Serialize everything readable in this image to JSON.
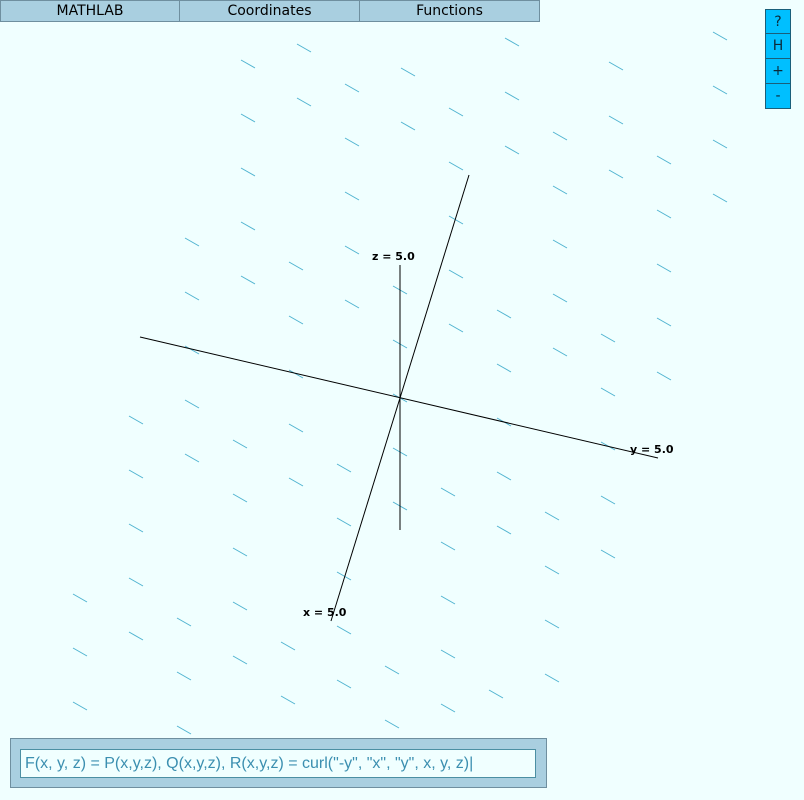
{
  "menu": {
    "tabs": [
      {
        "label": "MATHLAB"
      },
      {
        "label": "Coordinates"
      },
      {
        "label": "Functions"
      }
    ]
  },
  "side_buttons": [
    {
      "label": "?"
    },
    {
      "label": "H"
    },
    {
      "label": "+"
    },
    {
      "label": "-"
    }
  ],
  "axes": {
    "x_label": "x = 5.0",
    "y_label": "y = 5.0",
    "z_label": "z = 5.0"
  },
  "command": {
    "value": "F(x, y, z) = P(x,y,z), Q(x,y,z), R(x,y,z) = curl(\"-y\", \"x\", \"y\", x, y, z)|"
  },
  "colors": {
    "background": "#f0ffff",
    "field_arrow": "#4fb3d0",
    "menu_bg": "#a9cfe0",
    "side_button_bg": "#00bfff"
  }
}
